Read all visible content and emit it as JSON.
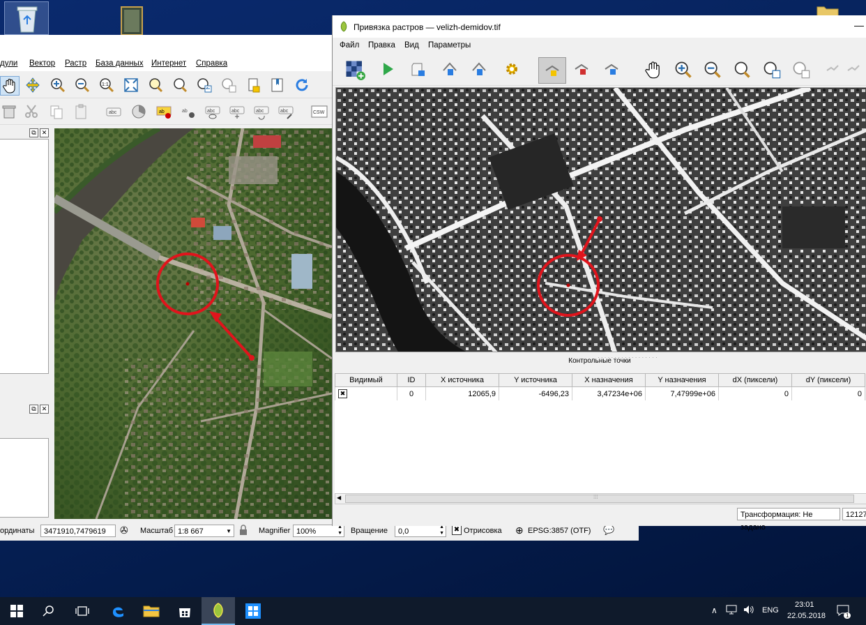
{
  "colors": {
    "accent": "#0078d7",
    "circle": "#e0141c",
    "desktop": "#0a2a6e"
  },
  "qgis": {
    "menu": [
      "дули",
      "Вектор",
      "Растр",
      "База данных",
      "Интернет",
      "Справка"
    ],
    "status": {
      "coords_label": "ординаты",
      "coords_value": "3471910,7479619",
      "scale_label": "Масштаб",
      "scale_value": "1:8 667",
      "magnifier_label": "Magnifier",
      "magnifier_value": "100%",
      "rotation_label": "Вращение",
      "rotation_value": "0,0",
      "render_label": "Отрисовка",
      "crs_label": "EPSG:3857 (OTF)"
    }
  },
  "georef": {
    "title": "Привязка растров — velizh-demidov.tif",
    "menu": [
      "Файл",
      "Правка",
      "Вид",
      "Параметры"
    ],
    "gcp_title": "Контрольные точки",
    "columns": [
      "Видимый",
      "ID",
      "X источника",
      "Y источника",
      "X назначения",
      "Y назначения",
      "dX (пиксели)",
      "dY (пиксели)"
    ],
    "rows": [
      {
        "visible": "✖",
        "id": "0",
        "x_src": "12065,9",
        "y_src": "-6496,23",
        "x_dst": "3,47234e+06",
        "y_dst": "7,47999e+06",
        "dx": "0",
        "dy": "0"
      }
    ],
    "transform_label": "Трансформация: Не задано",
    "status_cut": "12127"
  },
  "taskbar": {
    "lang": "ENG",
    "time": "23:01",
    "date": "22.05.2018",
    "notif_count": "1"
  }
}
